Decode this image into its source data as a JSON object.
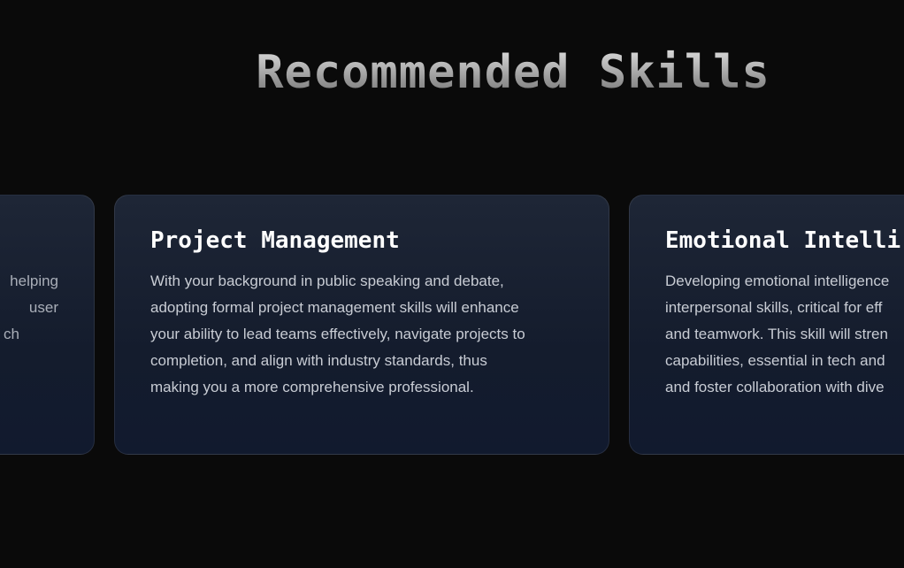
{
  "section": {
    "title": "Recommended Skills"
  },
  "cards": [
    {
      "title": "",
      "lines": [
        "helping",
        "user",
        "ch"
      ]
    },
    {
      "title": "Project Management",
      "lines": [
        "With your background in public speaking and debate,",
        "adopting formal project management skills will enhance",
        "your ability to lead teams effectively, navigate projects to",
        "completion, and align with industry standards, thus",
        "making you a more comprehensive professional."
      ]
    },
    {
      "title": "Emotional Intelli",
      "lines": [
        "Developing emotional intelligence",
        "interpersonal skills, critical for eff",
        "and teamwork. This skill will stren",
        "capabilities, essential in tech and",
        "and foster collaboration with dive"
      ]
    }
  ],
  "colors": {
    "background": "#0a0a0a",
    "card_top": "#1e2636",
    "card_bottom": "#111a2e",
    "title_text": "#ffffff",
    "body_text": "#c8ccd4"
  }
}
